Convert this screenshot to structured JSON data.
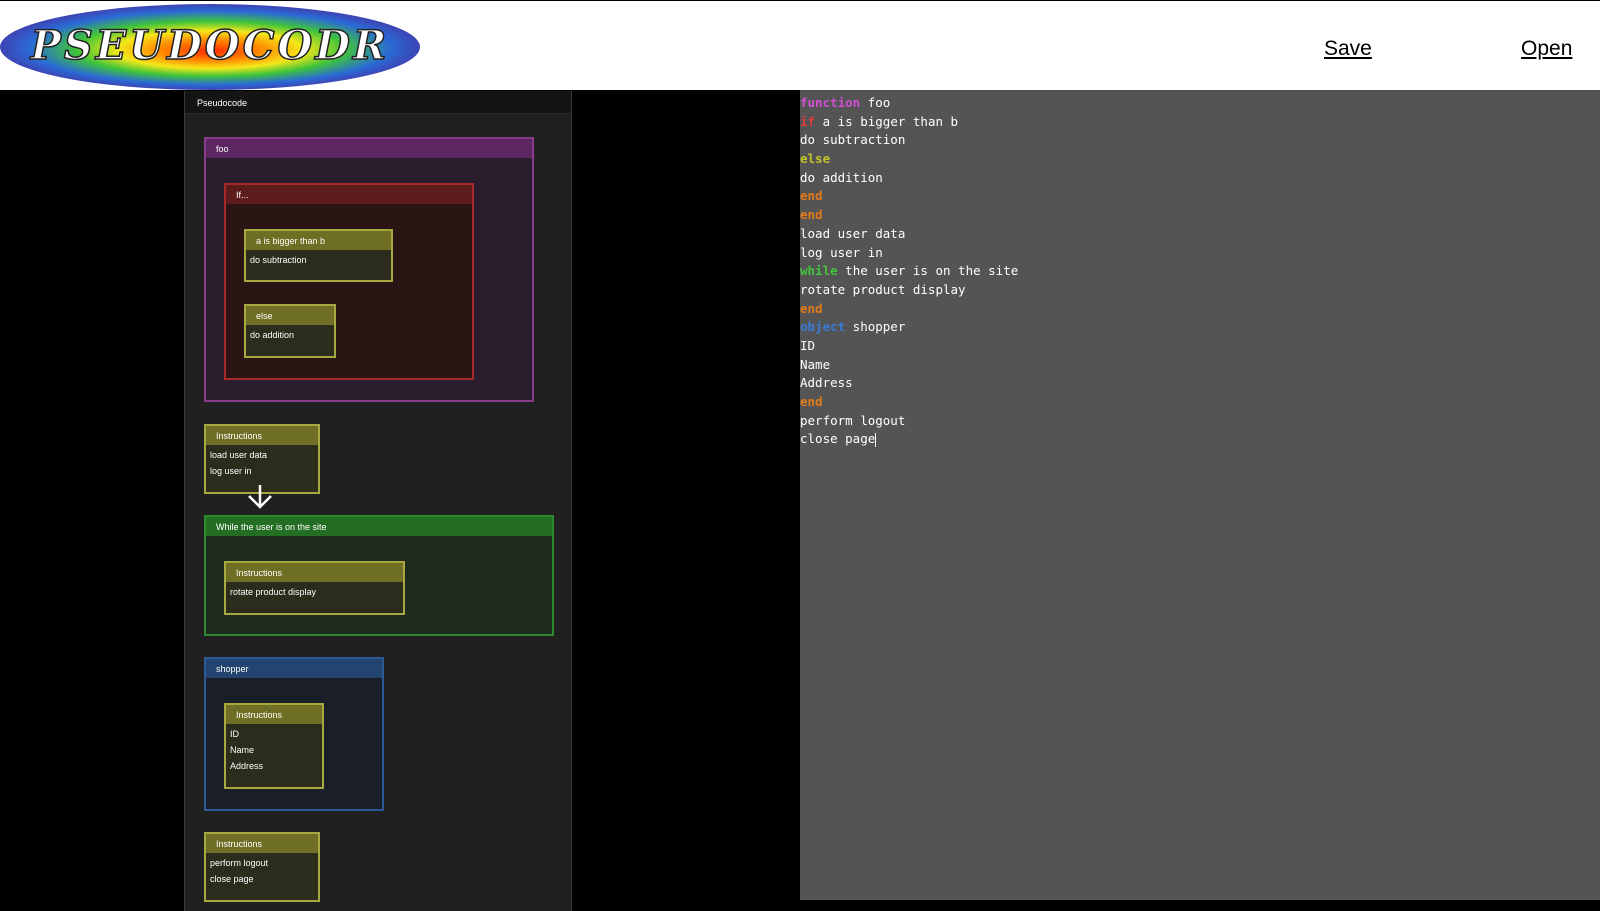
{
  "header": {
    "logo_text": "PSEUDOCODR",
    "save_label": "Save",
    "open_label": "Open"
  },
  "flowchart": {
    "panel_title": "Pseudocode",
    "function_block": {
      "name": "foo",
      "if_block": {
        "title": "If...",
        "condition": {
          "title": "a is bigger than b",
          "lines": [
            "do subtraction"
          ]
        },
        "else": {
          "title": "else",
          "lines": [
            "do addition"
          ]
        }
      }
    },
    "instructions_1": {
      "title": "Instructions",
      "lines": [
        "load user data",
        "log user in"
      ]
    },
    "while_block": {
      "title": "While the user is on the site",
      "instructions": {
        "title": "Instructions",
        "lines": [
          "rotate product display"
        ]
      }
    },
    "object_block": {
      "name": "shopper",
      "instructions": {
        "title": "Instructions",
        "lines": [
          "ID",
          "Name",
          "Address"
        ]
      }
    },
    "instructions_2": {
      "title": "Instructions",
      "lines": [
        "perform logout",
        "close page"
      ]
    }
  },
  "editor": {
    "lines": [
      {
        "keyword": "function",
        "rest": " foo"
      },
      {
        "keyword": "if",
        "rest": " a is bigger than b"
      },
      {
        "keyword": "",
        "rest": "do subtraction"
      },
      {
        "keyword": "else",
        "rest": ""
      },
      {
        "keyword": "",
        "rest": "do addition"
      },
      {
        "keyword": "end",
        "rest": ""
      },
      {
        "keyword": "end",
        "rest": ""
      },
      {
        "keyword": "",
        "rest": "load user data"
      },
      {
        "keyword": "",
        "rest": "log user in"
      },
      {
        "keyword": "while",
        "rest": " the user is on the site"
      },
      {
        "keyword": "",
        "rest": "rotate product display"
      },
      {
        "keyword": "end",
        "rest": ""
      },
      {
        "keyword": "object",
        "rest": " shopper"
      },
      {
        "keyword": "",
        "rest": "ID"
      },
      {
        "keyword": "",
        "rest": "Name"
      },
      {
        "keyword": "",
        "rest": "Address"
      },
      {
        "keyword": "end",
        "rest": ""
      },
      {
        "keyword": "",
        "rest": "perform logout"
      },
      {
        "keyword": "",
        "rest": "close page"
      }
    ]
  },
  "colors": {
    "function": "#d14fd3",
    "if": "#e03c3c",
    "else": "#c2c229",
    "end": "#e07a1a",
    "while": "#45c23c",
    "object": "#3a7bd6",
    "editor_bg": "#545454"
  }
}
